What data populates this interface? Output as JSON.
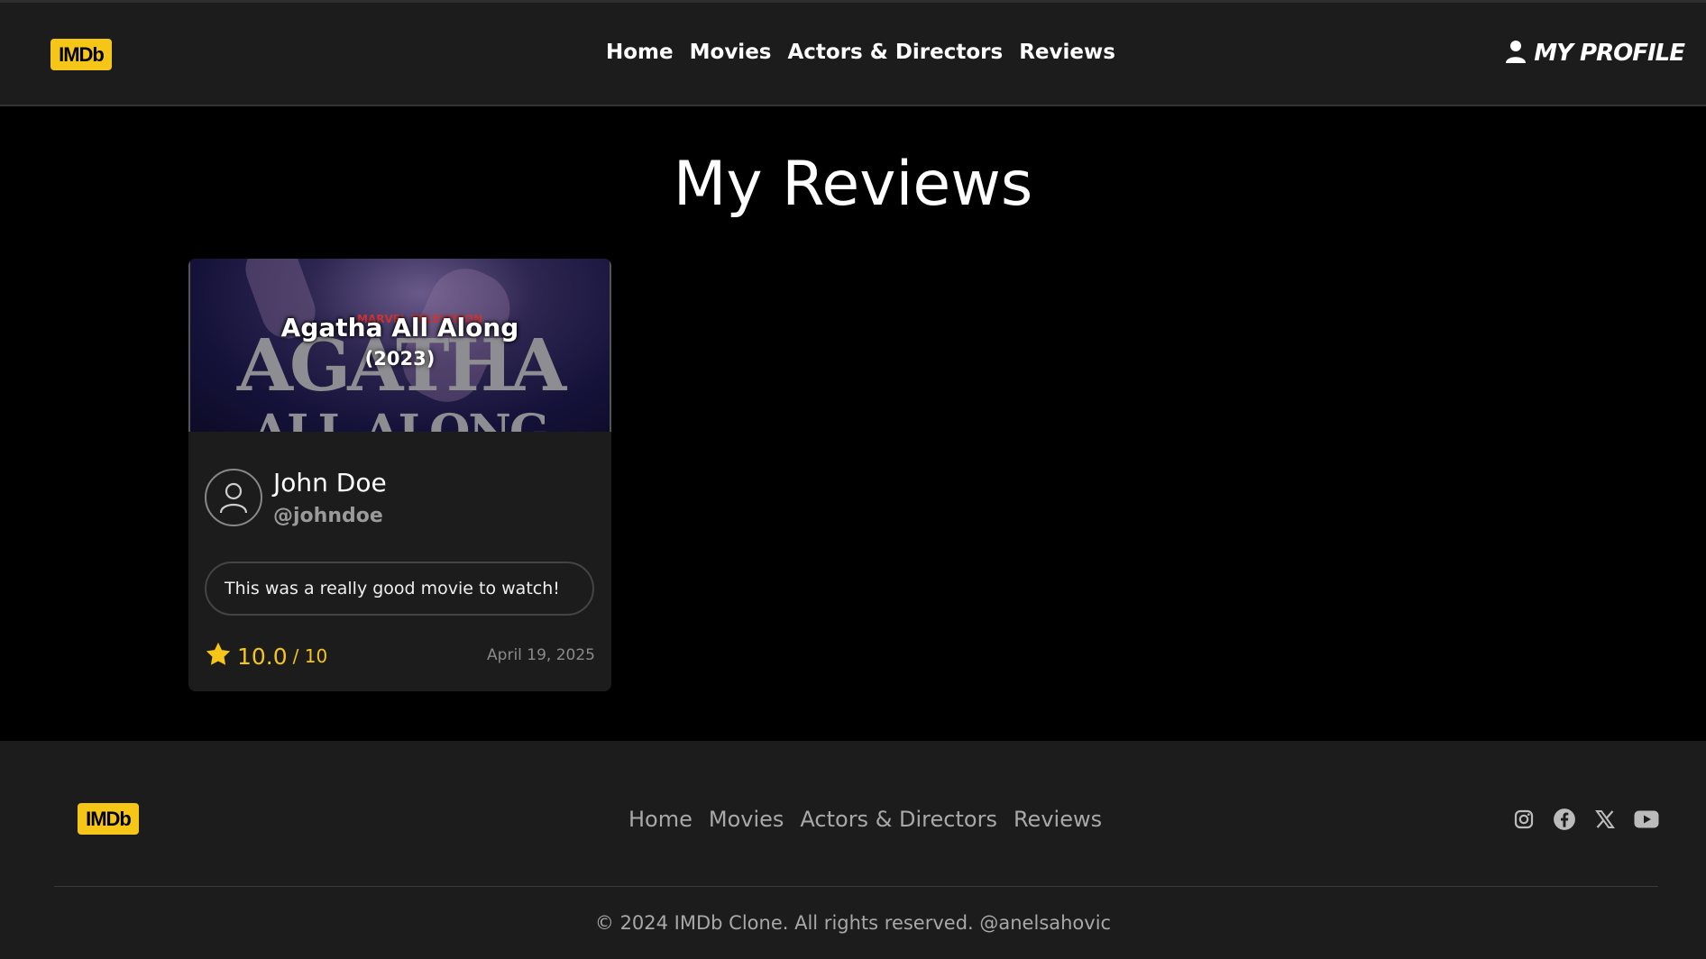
{
  "header": {
    "logo": "IMDb",
    "nav": [
      "Home",
      "Movies",
      "Actors & Directors",
      "Reviews"
    ],
    "profile_label": "MY PROFILE"
  },
  "page": {
    "title": "My Reviews"
  },
  "reviews": [
    {
      "poster_text": {
        "top": "MARVEL TELEVISION",
        "main": "AGATHA",
        "sub": "ALL ALONG"
      },
      "movie_title": "Agatha All Along",
      "movie_year": "(2023)",
      "user_name": "John Doe",
      "user_handle": "@johndoe",
      "text": "This was a really good movie to watch!",
      "rating": "10.0",
      "rating_max": "/ 10",
      "date": "April 19, 2025"
    }
  ],
  "footer": {
    "logo": "IMDb",
    "nav": [
      "Home",
      "Movies",
      "Actors & Directors",
      "Reviews"
    ],
    "social_icons": [
      "instagram-icon",
      "facebook-icon",
      "x-icon",
      "youtube-icon"
    ],
    "copyright": "© 2024 IMDb Clone. All rights reserved. @anelsahovic"
  },
  "colors": {
    "accent": "#f5c518",
    "header_bg": "#1c1c1c",
    "page_bg": "#000000"
  }
}
